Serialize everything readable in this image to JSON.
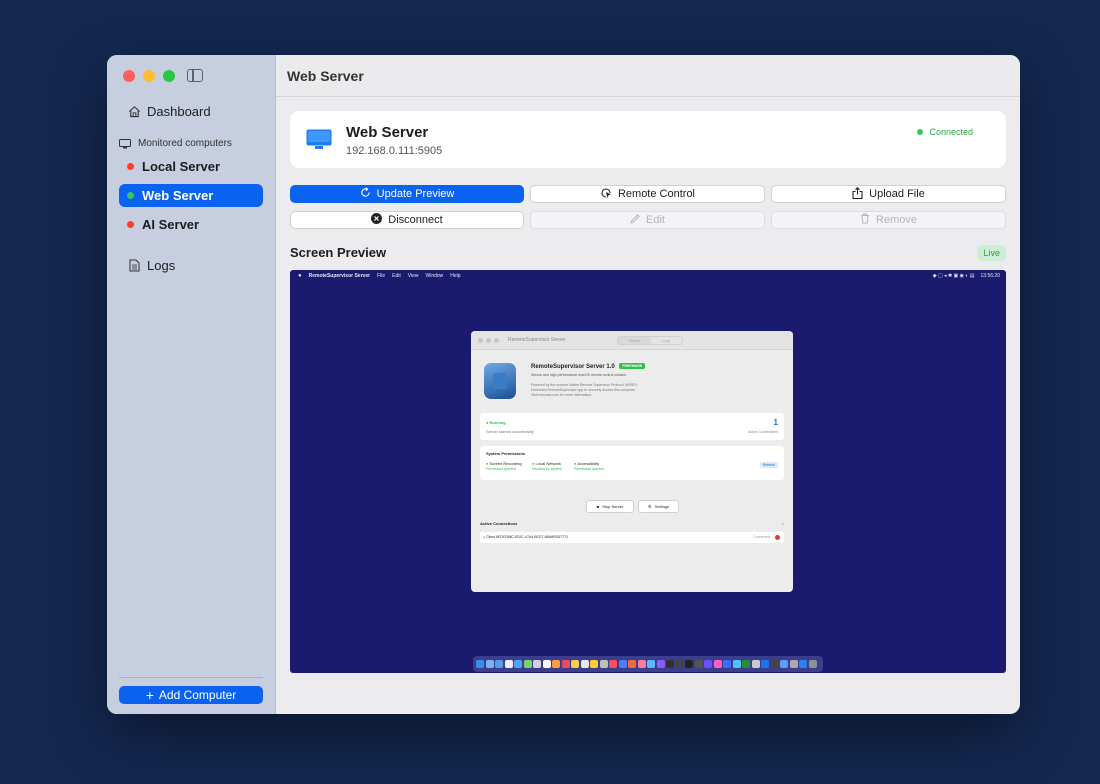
{
  "sidebar": {
    "dashboard": "Dashboard",
    "section_label": "Monitored computers",
    "computers": [
      {
        "name": "Local Server",
        "status": "red"
      },
      {
        "name": "Web Server",
        "status": "green"
      },
      {
        "name": "AI Server",
        "status": "red"
      }
    ],
    "logs": "Logs",
    "add_computer": "Add Computer"
  },
  "main": {
    "title": "Web Server",
    "computer": {
      "name": "Web Server",
      "address": "192.168.0.111:5905",
      "status": "Connected"
    },
    "actions": {
      "update_preview": "Update Preview",
      "remote_control": "Remote Control",
      "upload_file": "Upload File",
      "disconnect": "Disconnect",
      "edit": "Edit",
      "remove": "Remove"
    },
    "preview": {
      "title": "Screen Preview",
      "badge": "Live"
    }
  },
  "remote_screen": {
    "menubar": {
      "app": "RemoteSupervisor Server",
      "menus": [
        "File",
        "Edit",
        "View",
        "Window",
        "Help"
      ],
      "clock": "13:56:20"
    },
    "window": {
      "title": "RemoteSupervisor Server",
      "tabs": [
        "Status",
        "Logs"
      ],
      "app_name": "RemoteSupervisor Server 1.0",
      "badge": "FREEWARE",
      "subtitle": "Secure and high-performance macOS remote control solution",
      "desc_1": "Powered by the modern Native Remote Supervisor Protocol (NRSP).",
      "desc_2": "Download RemoteSupervisor app to securely access this computer.",
      "desc_3": "Visit mxuwas.com for more information.",
      "running": "Running",
      "running_sub": "Server started successfully",
      "active_count": "1",
      "active_label": "Active Connections",
      "perm_title": "System Permissions",
      "perms": [
        {
          "name": "Screen Recording",
          "state": "Permission granted"
        },
        {
          "name": "Local Network",
          "state": "Handled by system"
        },
        {
          "name": "Accessibility",
          "state": "Permission granted"
        }
      ],
      "refresh": "Refresh",
      "stop_server": "Stop Server",
      "settings": "Settings",
      "connections_title": "Active Connections",
      "connections_count": "1",
      "client": "Client AFDFD58C-E02C-47A4-BCE7-B8A6FBD7771",
      "client_status": "Connected"
    }
  },
  "colors": {
    "accent": "#0a63f0",
    "connected": "#34c759",
    "offline": "#ff3b30",
    "remote_bg": "#1a1b6e"
  }
}
